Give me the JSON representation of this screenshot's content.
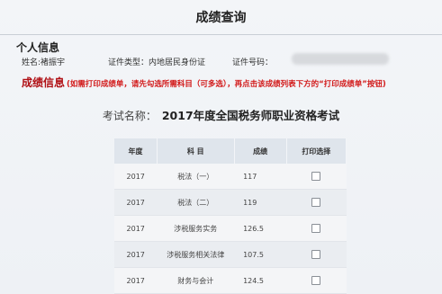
{
  "header": {
    "title": "成绩查询"
  },
  "personal": {
    "heading": "个人信息",
    "name": "姓名:褚振宇",
    "id_type": "证件类型：内地居民身份证",
    "id_number_label": "证件号码："
  },
  "scores": {
    "heading": "成绩信息",
    "note": "(如需打印成绩单，请先勾选所需科目（可多选），再点击该成绩列表下方的“打印成绩单”按钮)"
  },
  "exam": {
    "label": "考试名称：",
    "name": "2017年度全国税务师职业资格考试"
  },
  "table": {
    "headers": [
      "年度",
      "科  目",
      "成绩",
      "打印选择"
    ],
    "rows": [
      {
        "year": "2017",
        "subject": "税法（一）",
        "score": "117"
      },
      {
        "year": "2017",
        "subject": "税法（二）",
        "score": "119"
      },
      {
        "year": "2017",
        "subject": "涉税服务实务",
        "score": "126.5"
      },
      {
        "year": "2017",
        "subject": "涉税服务相关法律",
        "score": "107.5"
      },
      {
        "year": "2017",
        "subject": "财务与会计",
        "score": "124.5"
      }
    ]
  }
}
